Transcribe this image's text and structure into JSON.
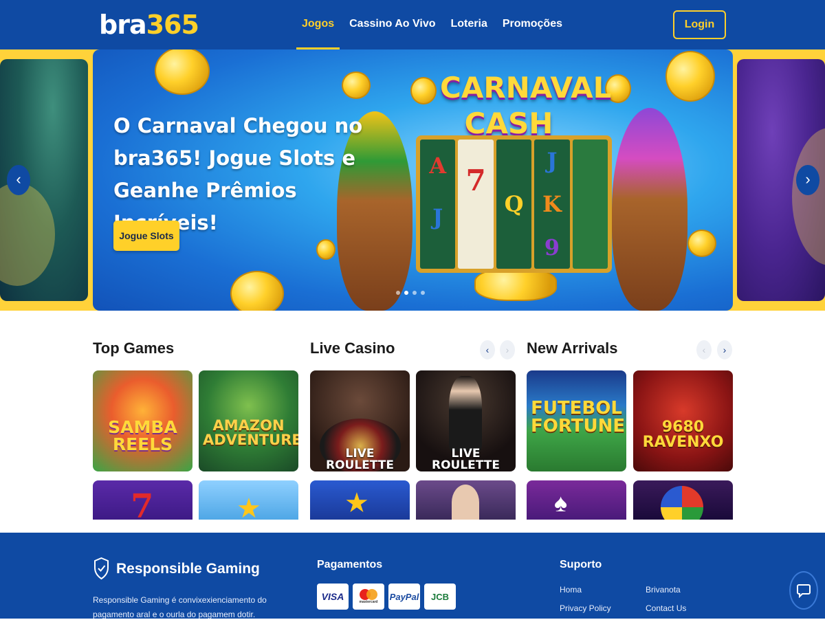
{
  "brand": {
    "logo_part1": "bra",
    "logo_part2": "365"
  },
  "nav": {
    "items": [
      {
        "label": "Jogos",
        "active": true
      },
      {
        "label": "Cassino Ao Vivo",
        "active": false
      },
      {
        "label": "Loteria",
        "active": false
      },
      {
        "label": "Promoções",
        "active": false
      }
    ],
    "login_label": "Login"
  },
  "hero": {
    "title": "O Carnaval Chegou no bra365! Jogue Slots e Geanhe Prêmios Incríveis!",
    "cta_label": "Jogue Slots",
    "game_title_line1": "CARNAVAL",
    "game_title_line2": "CASH",
    "reel_symbols": [
      "A",
      "J",
      "",
      "7",
      "",
      "Q",
      "J",
      "K",
      "9"
    ],
    "slide_count": 4,
    "active_slide": 2
  },
  "sections": {
    "top_games": {
      "title": "Top Games",
      "cards": [
        {
          "label": "SAMBA REELS"
        },
        {
          "label": "AMAZON ADVENTURE"
        }
      ]
    },
    "live_casino": {
      "title": "Live Casino",
      "cards": [
        {
          "label": "LIVE ROULETTE"
        },
        {
          "label": "LIVE ROULETTE"
        }
      ]
    },
    "new_arrivals": {
      "title": "New Arrivals",
      "cards": [
        {
          "label": "FUTEBOL FORTUNE"
        },
        {
          "label": "9680 RAVENXO"
        }
      ]
    }
  },
  "footer": {
    "rg_title": "Responsible Gaming",
    "rg_text": "Responsible Gaming é convixexienciamento do pagamento aral e o ourla do pagamem dotir.",
    "payments_title": "Pagamentos",
    "payments": [
      "VISA",
      "mastercard",
      "PayPal",
      "JCB"
    ],
    "support_title": "Suporto",
    "support_links": [
      "Homa",
      "Privacy Policy",
      "Brivanota",
      "Contact Us"
    ]
  },
  "colors": {
    "brand_blue": "#0f4aa3",
    "accent_yellow": "#ffd029"
  }
}
